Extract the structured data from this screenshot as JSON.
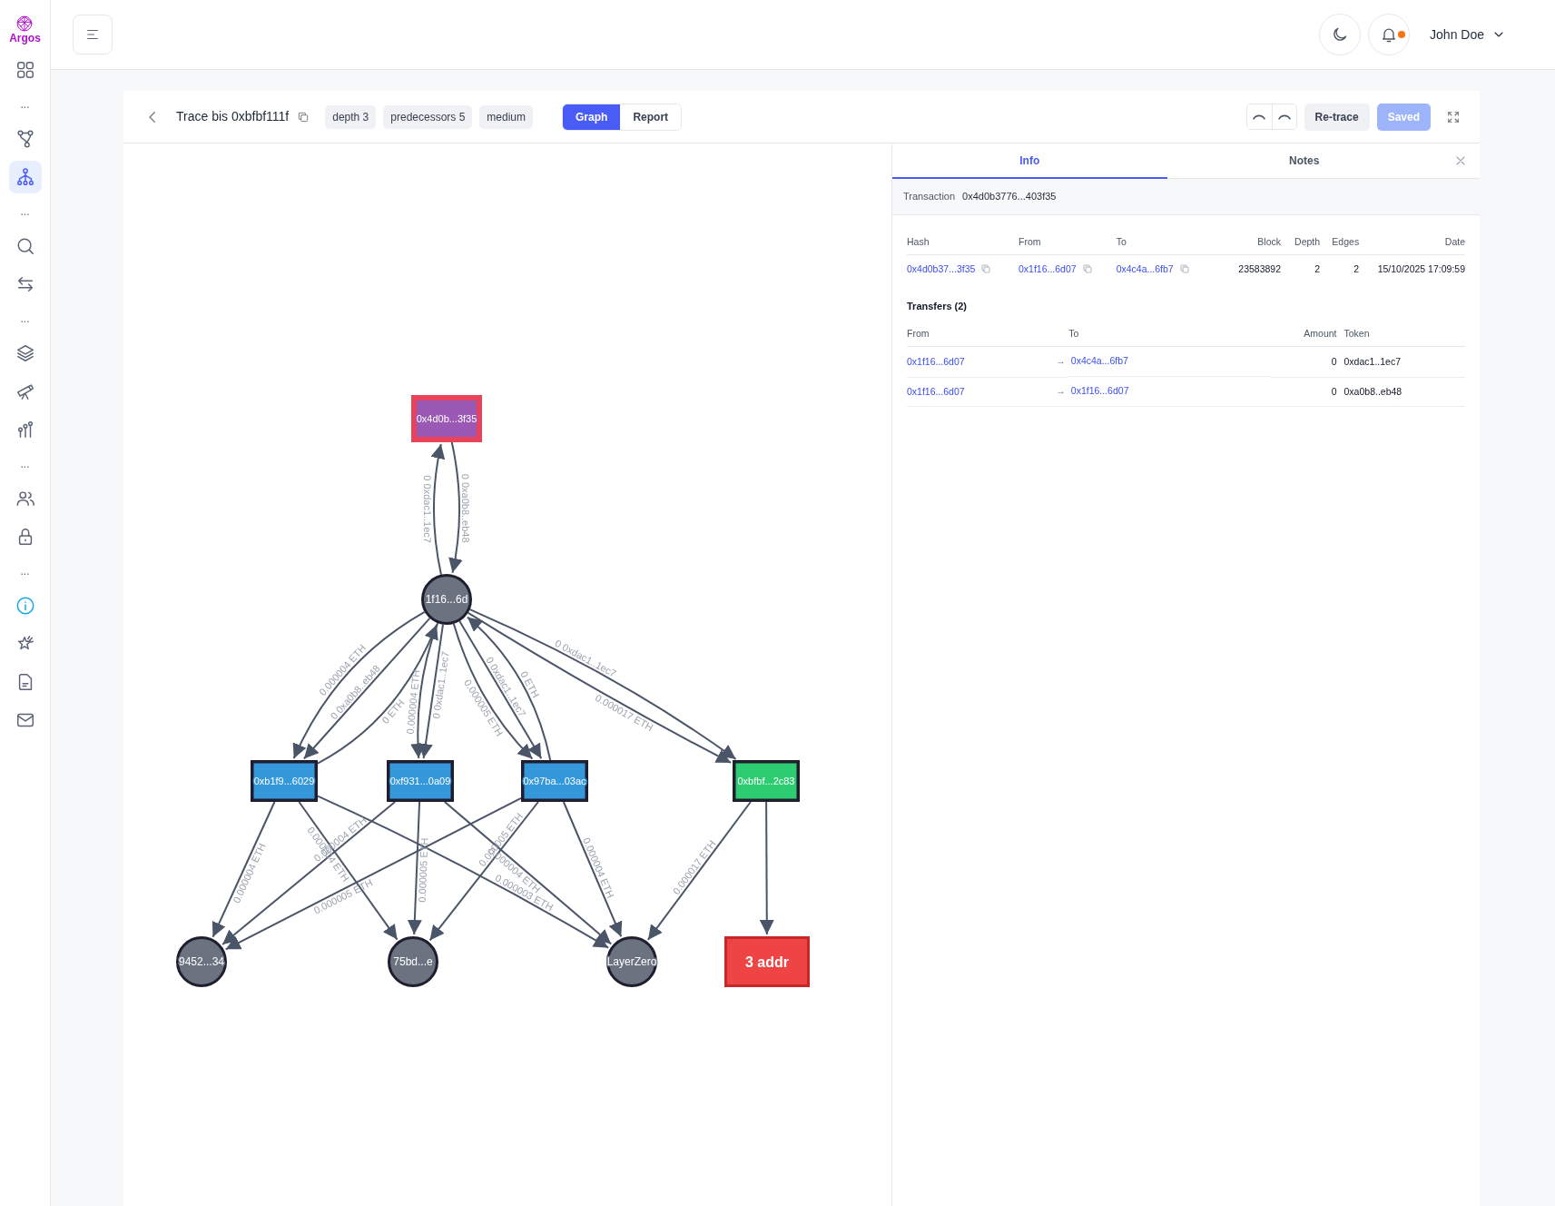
{
  "app": {
    "logo_text": "Argos"
  },
  "sidebar": {
    "items": [
      {
        "kind": "icon",
        "selected": false
      },
      {
        "kind": "more",
        "text": "..."
      },
      {
        "kind": "icon",
        "selected": false
      },
      {
        "kind": "icon",
        "selected": true
      },
      {
        "kind": "more",
        "text": "..."
      },
      {
        "kind": "icon",
        "selected": false
      },
      {
        "kind": "icon",
        "selected": false
      },
      {
        "kind": "more",
        "text": "..."
      },
      {
        "kind": "icon",
        "selected": false
      },
      {
        "kind": "icon",
        "selected": false
      },
      {
        "kind": "icon",
        "selected": false
      },
      {
        "kind": "more",
        "text": "..."
      },
      {
        "kind": "icon",
        "selected": false
      },
      {
        "kind": "icon",
        "selected": false
      },
      {
        "kind": "more",
        "text": "..."
      },
      {
        "kind": "icon",
        "selected": false
      },
      {
        "kind": "icon",
        "selected": false
      },
      {
        "kind": "icon",
        "selected": false
      },
      {
        "kind": "icon",
        "selected": false
      }
    ]
  },
  "header": {
    "user": "John Doe",
    "unread": true
  },
  "toolbar": {
    "title": "Trace bis 0xbfbf111f",
    "badges": [
      "depth 3",
      "predecessors 5",
      "medium"
    ],
    "views": [
      {
        "label": "Graph",
        "selected": true
      },
      {
        "label": "Report",
        "selected": false
      }
    ],
    "retrace": "Re-trace",
    "save": {
      "label": "Saved",
      "disabled": true
    }
  },
  "graph": {
    "nodes": [
      {
        "label": "0x4d0b...3f35",
        "kind": "box",
        "color": "#9b59b6",
        "selected": true
      },
      {
        "label": "1f16...6d",
        "kind": "circle",
        "color": "#6b7280",
        "selected": false
      },
      {
        "label": "0xb1f9...6029",
        "kind": "box",
        "color": "#3498db",
        "selected": false
      },
      {
        "label": "0xf931...0a09",
        "kind": "box",
        "color": "#3498db",
        "selected": false
      },
      {
        "label": "0x97ba...03ac",
        "kind": "box",
        "color": "#3498db",
        "selected": false
      },
      {
        "label": "0xbfbf...2c83",
        "kind": "box",
        "color": "#2ecc71",
        "selected": false
      },
      {
        "label": "9452...34",
        "kind": "circle",
        "color": "#6b7280",
        "selected": false
      },
      {
        "label": "75bd...e",
        "kind": "circle",
        "color": "#6b7280",
        "selected": false
      },
      {
        "label": "LayerZero",
        "kind": "circle",
        "color": "#6b7280",
        "selected": false
      },
      {
        "label": "3 addr",
        "kind": "group",
        "color": "#ef4444",
        "selected": false
      }
    ],
    "edges": [
      {
        "label": "0 0xa0b8..eb48"
      },
      {
        "label": "0 0xdac1..1ec7"
      },
      {
        "label": "0.000004 ETH"
      },
      {
        "label": "0 0xa0b8..eb48"
      },
      {
        "label": "0 ETH"
      },
      {
        "label": "0.000004 ETH"
      },
      {
        "label": "0 0xdac1..1ec7"
      },
      {
        "label": "0.000005 ETH"
      },
      {
        "label": "0 0xdac1..1ec7"
      },
      {
        "label": "0 ETH"
      },
      {
        "label": "0 0xdac1..1ec7"
      },
      {
        "label": "0.000017 ETH"
      },
      {
        "label": "0.000004 ETH"
      },
      {
        "label": "0.000004 ETH"
      },
      {
        "label": "0.000003 ETH"
      },
      {
        "label": "0.000004 ETH"
      },
      {
        "label": "0.000005 ETH"
      },
      {
        "label": "0.000004 ETH"
      },
      {
        "label": "0.000005 ETH"
      },
      {
        "label": "0.000005 ETH"
      },
      {
        "label": "0.000004 ETH"
      },
      {
        "label": "0.000017 ETH"
      }
    ]
  },
  "panel": {
    "tabs": [
      {
        "label": "Info",
        "selected": true
      },
      {
        "label": "Notes",
        "selected": false
      }
    ],
    "transaction": {
      "label": "Transaction",
      "value": "0x4d0b3776...403f35"
    },
    "tx_table": {
      "columns": [
        "Hash",
        "From",
        "To",
        "Block",
        "Depth",
        "Edges",
        "Date"
      ],
      "rows": [
        {
          "hash": "0x4d0b37...3f35",
          "from": "0x1f16...6d07",
          "to": "0x4c4a...6fb7",
          "block": "23583892",
          "depth": "2",
          "edges": "2",
          "date": "15/10/2025 17:09:59"
        }
      ]
    },
    "transfers": {
      "title": "Transfers (2)",
      "columns": [
        "From",
        "To",
        "Amount",
        "Token"
      ],
      "rows": [
        {
          "from": "0x1f16...6d07",
          "arrow": "→",
          "to": "0x4c4a...6fb7",
          "amount": "0",
          "token": "0xdac1..1ec7"
        },
        {
          "from": "0x1f16...6d07",
          "arrow": "→",
          "to": "0x1f16...6d07",
          "amount": "0",
          "token": "0xa0b8..eb48"
        }
      ]
    }
  }
}
